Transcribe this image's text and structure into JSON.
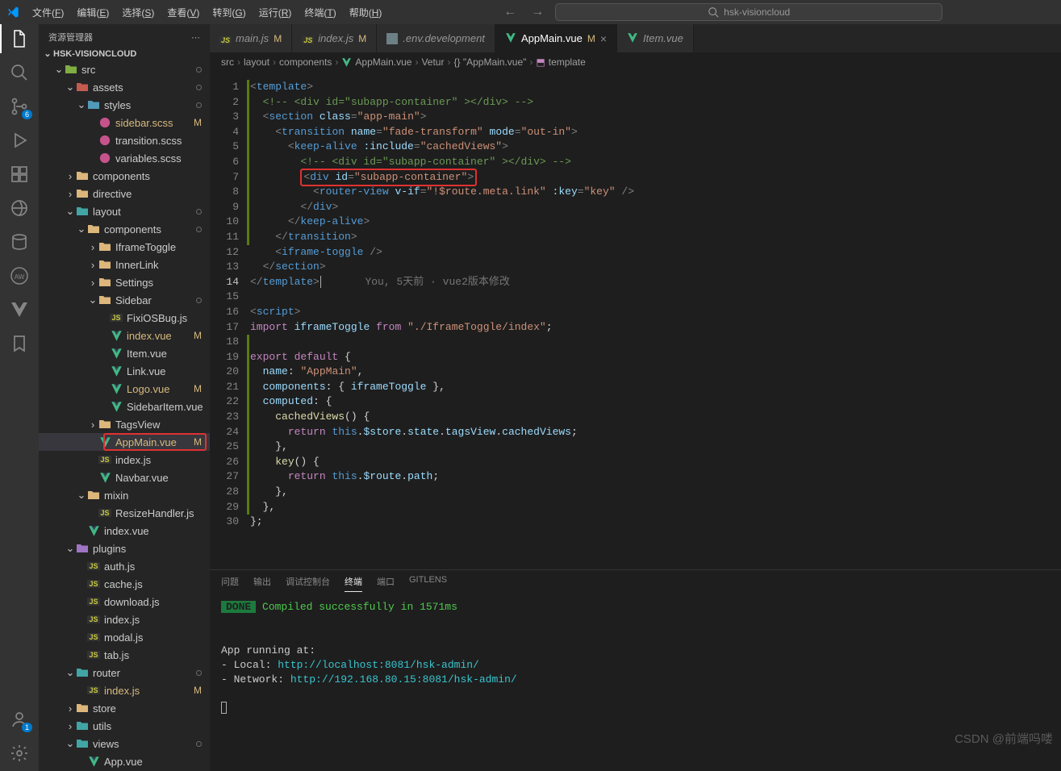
{
  "menubar": {
    "items": [
      {
        "label": "文件",
        "key": "F"
      },
      {
        "label": "编辑",
        "key": "E"
      },
      {
        "label": "选择",
        "key": "S"
      },
      {
        "label": "查看",
        "key": "V"
      },
      {
        "label": "转到",
        "key": "G"
      },
      {
        "label": "运行",
        "key": "R"
      },
      {
        "label": "终端",
        "key": "T"
      },
      {
        "label": "帮助",
        "key": "H"
      }
    ],
    "search_placeholder": "hsk-visioncloud"
  },
  "activitybar": {
    "scm_badge": "6",
    "account_badge": "1"
  },
  "sidebar": {
    "title": "资源管理器",
    "root": "HSK-VISIONCLOUD",
    "tree": [
      {
        "d": 1,
        "t": "folder-open",
        "c": "folder-green",
        "l": "src",
        "dot": true
      },
      {
        "d": 2,
        "t": "folder-open",
        "c": "folder-red",
        "l": "assets",
        "dot": true
      },
      {
        "d": 3,
        "t": "folder-open",
        "c": "folder-blue",
        "l": "styles",
        "dot": true
      },
      {
        "d": 4,
        "t": "scss",
        "l": "sidebar.scss",
        "m": "M"
      },
      {
        "d": 4,
        "t": "scss",
        "l": "transition.scss"
      },
      {
        "d": 4,
        "t": "scss",
        "l": "variables.scss"
      },
      {
        "d": 2,
        "t": "folder",
        "c": "folder-yellow",
        "l": "components"
      },
      {
        "d": 2,
        "t": "folder",
        "c": "folder-yellow",
        "l": "directive"
      },
      {
        "d": 2,
        "t": "folder-open",
        "c": "folder-teal",
        "l": "layout",
        "dot": true
      },
      {
        "d": 3,
        "t": "folder-open",
        "c": "folder-yellow",
        "l": "components",
        "dot": true
      },
      {
        "d": 4,
        "t": "folder",
        "c": "folder-yellow",
        "l": "IframeToggle"
      },
      {
        "d": 4,
        "t": "folder",
        "c": "folder-yellow",
        "l": "InnerLink"
      },
      {
        "d": 4,
        "t": "folder",
        "c": "folder-yellow",
        "l": "Settings"
      },
      {
        "d": 4,
        "t": "folder-open",
        "c": "folder-yellow",
        "l": "Sidebar",
        "dot": true
      },
      {
        "d": 5,
        "t": "js",
        "l": "FixiOSBug.js"
      },
      {
        "d": 5,
        "t": "vue",
        "l": "index.vue",
        "m": "M"
      },
      {
        "d": 5,
        "t": "vue",
        "l": "Item.vue"
      },
      {
        "d": 5,
        "t": "vue",
        "l": "Link.vue"
      },
      {
        "d": 5,
        "t": "vue",
        "l": "Logo.vue",
        "m": "M"
      },
      {
        "d": 5,
        "t": "vue",
        "l": "SidebarItem.vue"
      },
      {
        "d": 4,
        "t": "folder",
        "c": "folder-yellow",
        "l": "TagsView"
      },
      {
        "d": 4,
        "t": "vue",
        "l": "AppMain.vue",
        "m": "M",
        "sel": true,
        "red": true
      },
      {
        "d": 4,
        "t": "js",
        "l": "index.js"
      },
      {
        "d": 4,
        "t": "vue",
        "l": "Navbar.vue"
      },
      {
        "d": 3,
        "t": "folder-open",
        "c": "folder-yellow",
        "l": "mixin"
      },
      {
        "d": 4,
        "t": "js",
        "l": "ResizeHandler.js"
      },
      {
        "d": 3,
        "t": "vue",
        "l": "index.vue"
      },
      {
        "d": 2,
        "t": "folder-open",
        "c": "folder-purple",
        "l": "plugins"
      },
      {
        "d": 3,
        "t": "js",
        "l": "auth.js"
      },
      {
        "d": 3,
        "t": "js",
        "l": "cache.js"
      },
      {
        "d": 3,
        "t": "js",
        "l": "download.js"
      },
      {
        "d": 3,
        "t": "js",
        "l": "index.js"
      },
      {
        "d": 3,
        "t": "js",
        "l": "modal.js"
      },
      {
        "d": 3,
        "t": "js",
        "l": "tab.js"
      },
      {
        "d": 2,
        "t": "folder-open",
        "c": "folder-teal",
        "l": "router",
        "dot": true
      },
      {
        "d": 3,
        "t": "js",
        "l": "index.js",
        "m": "M"
      },
      {
        "d": 2,
        "t": "folder",
        "c": "folder-yellow",
        "l": "store"
      },
      {
        "d": 2,
        "t": "folder",
        "c": "folder-teal",
        "l": "utils"
      },
      {
        "d": 2,
        "t": "folder-open",
        "c": "folder-teal",
        "l": "views",
        "dot": true
      },
      {
        "d": 3,
        "t": "vue",
        "l": "App.vue"
      }
    ]
  },
  "tabs": [
    {
      "icon": "js",
      "label": "main.js",
      "git": "M"
    },
    {
      "icon": "js",
      "label": "index.js",
      "git": "M"
    },
    {
      "icon": "env",
      "label": ".env.development"
    },
    {
      "icon": "vue",
      "label": "AppMain.vue",
      "git": "M",
      "active": true,
      "close": true,
      "regular": true
    },
    {
      "icon": "vue",
      "label": "Item.vue"
    }
  ],
  "breadcrumb": [
    "src",
    "layout",
    "components",
    "AppMain.vue",
    "Vetur",
    "{} \"AppMain.vue\"",
    "template"
  ],
  "code": {
    "lens": "You, 5天前 · vue2版本修改",
    "lines": 30
  },
  "panel": {
    "tabs": [
      "问题",
      "输出",
      "调试控制台",
      "终端",
      "端口",
      "GITLENS"
    ],
    "active": 3,
    "done": "DONE",
    "compiled": "Compiled successfully in 1571ms",
    "running": "App running at:",
    "local_label": "- Local:   ",
    "local_url": "http://localhost:8081/hsk-admin/",
    "network_label": "- Network: ",
    "network_url": "http://192.168.80.15:8081/hsk-admin/"
  },
  "watermark": "CSDN @前端吗喽"
}
